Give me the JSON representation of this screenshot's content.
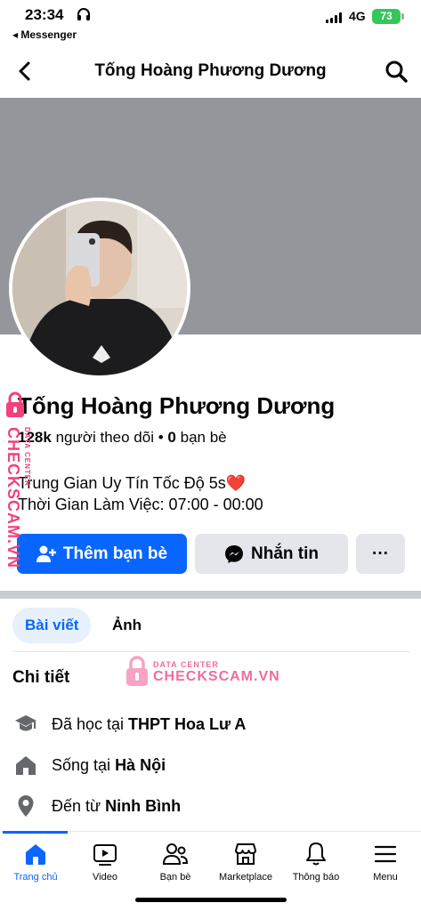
{
  "status_bar": {
    "time": "23:34",
    "back_app": "◂ Messenger",
    "network": "4G",
    "battery": "73"
  },
  "header": {
    "title": "Tống Hoàng Phương Dương"
  },
  "profile": {
    "name": "Tống Hoàng Phương Dương",
    "followers_count": "128k",
    "followers_label": "người theo dõi",
    "separator": "•",
    "friends_count": "0",
    "friends_label": "bạn bè",
    "bio_line1": "Trung Gian Uy Tín Tốc Độ 5s❤️",
    "bio_line2": "Thời Gian Làm Việc: 07:00 - 00:00"
  },
  "actions": {
    "add_friend": "Thêm bạn bè",
    "message": "Nhắn tin",
    "more": "···"
  },
  "tabs": [
    {
      "label": "Bài viết",
      "active": true
    },
    {
      "label": "Ảnh",
      "active": false
    }
  ],
  "details": {
    "title": "Chi tiết",
    "items": [
      {
        "icon": "school-icon",
        "prefix": "Đã học tại",
        "value": "THPT Hoa Lư A"
      },
      {
        "icon": "home-icon",
        "prefix": "Sống tại",
        "value": "Hà Nội"
      },
      {
        "icon": "location-pin-icon",
        "prefix": "Đến từ",
        "value": "Ninh Bình"
      }
    ]
  },
  "bottom_nav": [
    {
      "label": "Trang chủ",
      "icon": "home-icon",
      "active": true
    },
    {
      "label": "Video",
      "icon": "video-icon",
      "active": false
    },
    {
      "label": "Bạn bè",
      "icon": "friends-icon",
      "active": false
    },
    {
      "label": "Marketplace",
      "icon": "marketplace-icon",
      "active": false
    },
    {
      "label": "Thông báo",
      "icon": "bell-icon",
      "active": false
    },
    {
      "label": "Menu",
      "icon": "menu-icon",
      "active": false
    }
  ],
  "watermark": {
    "side_text": "CHECKSCAM.VN",
    "side_small": "DATA CENTER",
    "center_small": "DATA CENTER",
    "center_text": "CHECKSCAM.VN"
  },
  "colors": {
    "accent": "#0866ff",
    "cover": "#94969b",
    "button_secondary": "#e4e6eb",
    "watermark": "#f2417f",
    "battery": "#34c759"
  }
}
